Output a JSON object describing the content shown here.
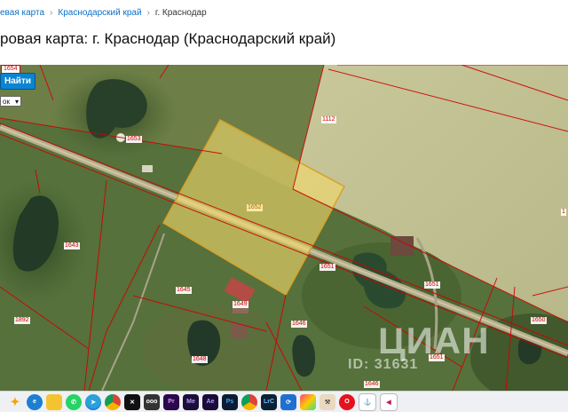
{
  "breadcrumb": {
    "items": [
      "евая карта",
      "Краснодарский край",
      "г. Краснодар"
    ],
    "separator": "›"
  },
  "page": {
    "title": "ровая карта: г. Краснодар (Краснодарский край)"
  },
  "map": {
    "find_button_label": "Найти",
    "top_tag": "1654",
    "select_value": "ок",
    "parcels": {
      "main": "1652",
      "p1653": "1653",
      "p1112": "1112",
      "p1643": "1643",
      "p1651a": "1651",
      "p1651b": "1651",
      "p1651c": "1651",
      "p1645": "1645",
      "p1646a": "1646",
      "p1646b": "1646",
      "p1892": "1892",
      "p1650": "1650",
      "p1648": "1648",
      "p1649": "1649",
      "p1": "1"
    },
    "highlight_color": "#f2d86a",
    "boundary_color": "#d00000"
  },
  "watermark": {
    "brand": "ЦИАН",
    "id": "ID: 31631"
  },
  "taskbar": {
    "icons": [
      "copilot-icon",
      "edge-icon",
      "file-explorer-icon",
      "whatsapp-icon",
      "telegram-icon",
      "chrome-icon",
      "capcut-icon",
      "cube-icon",
      "premiere-icon",
      "media-encoder-icon",
      "after-effects-icon",
      "photoshop-icon",
      "chrome-alt-icon",
      "lightroom-icon",
      "sourcetree-icon",
      "color-app-icon",
      "tool-icon",
      "opera-icon",
      "network-icon",
      "vs-icon"
    ],
    "labels": {
      "pr": "Pr",
      "me": "Me",
      "ae": "Ae",
      "ps": "Ps",
      "lrc": "LrC",
      "cube": "ooo"
    }
  }
}
